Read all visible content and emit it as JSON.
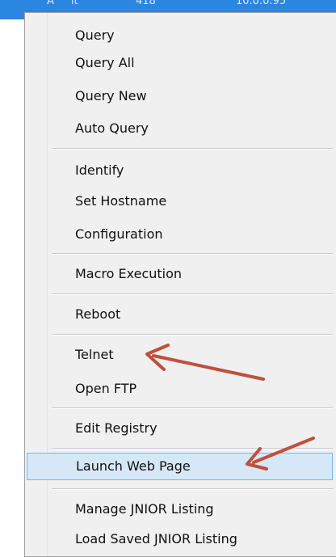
{
  "header": {
    "fragments": [
      "A",
      "lt",
      "418",
      "10.0.0.95"
    ]
  },
  "menu": {
    "items": [
      "Query",
      "Query All",
      "Query New",
      "Auto Query",
      "Identify",
      "Set Hostname",
      "Configuration",
      "Macro Execution",
      "Reboot",
      "Telnet",
      "Open FTP",
      "Edit Registry",
      "Launch Web Page",
      "Manage JNIOR  Listing",
      "Load Saved JNIOR Listing"
    ],
    "highlighted": "Launch Web Page"
  },
  "annotations": {
    "arrow_color": "#c0503c",
    "menu_highlight_color": "#d6e8f8"
  }
}
